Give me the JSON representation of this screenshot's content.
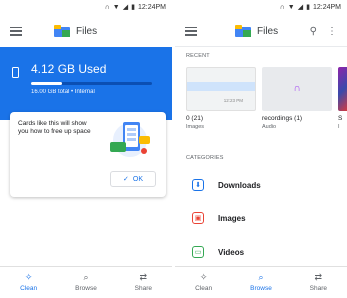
{
  "status_bar": {
    "time": "12:24PM"
  },
  "clean_screen": {
    "app_title": "Files",
    "storage": {
      "used_label": "4.12 GB Used",
      "detail": "16.00 GB total • Internal",
      "used_fraction": 0.26
    },
    "tip_card": {
      "text": "Cards like this will show you how to free up space",
      "ok_label": "OK"
    },
    "bottom_nav": [
      {
        "label": "Clean",
        "icon": "sparkle-icon",
        "active": true
      },
      {
        "label": "Browse",
        "icon": "browse-icon",
        "active": false
      },
      {
        "label": "Share",
        "icon": "share-icon",
        "active": false
      }
    ]
  },
  "browse_screen": {
    "app_title": "Files",
    "recent_header": "RECENT",
    "recent": [
      {
        "name": "0 (21)",
        "type": "Images"
      },
      {
        "name": "recordings (1)",
        "type": "Audio"
      },
      {
        "name": "S",
        "type": "I"
      }
    ],
    "categories_header": "CATEGORIES",
    "categories": [
      {
        "label": "Downloads",
        "icon": "download-icon",
        "color": "#1a73e8"
      },
      {
        "label": "Images",
        "icon": "image-icon",
        "color": "#ea4335"
      },
      {
        "label": "Videos",
        "icon": "video-icon",
        "color": "#34a853"
      }
    ],
    "bottom_nav": [
      {
        "label": "Clean",
        "icon": "sparkle-icon",
        "active": false
      },
      {
        "label": "Browse",
        "icon": "browse-icon",
        "active": true
      },
      {
        "label": "Share",
        "icon": "share-icon",
        "active": false
      }
    ]
  },
  "colors": {
    "accent": "#1a73e8"
  }
}
